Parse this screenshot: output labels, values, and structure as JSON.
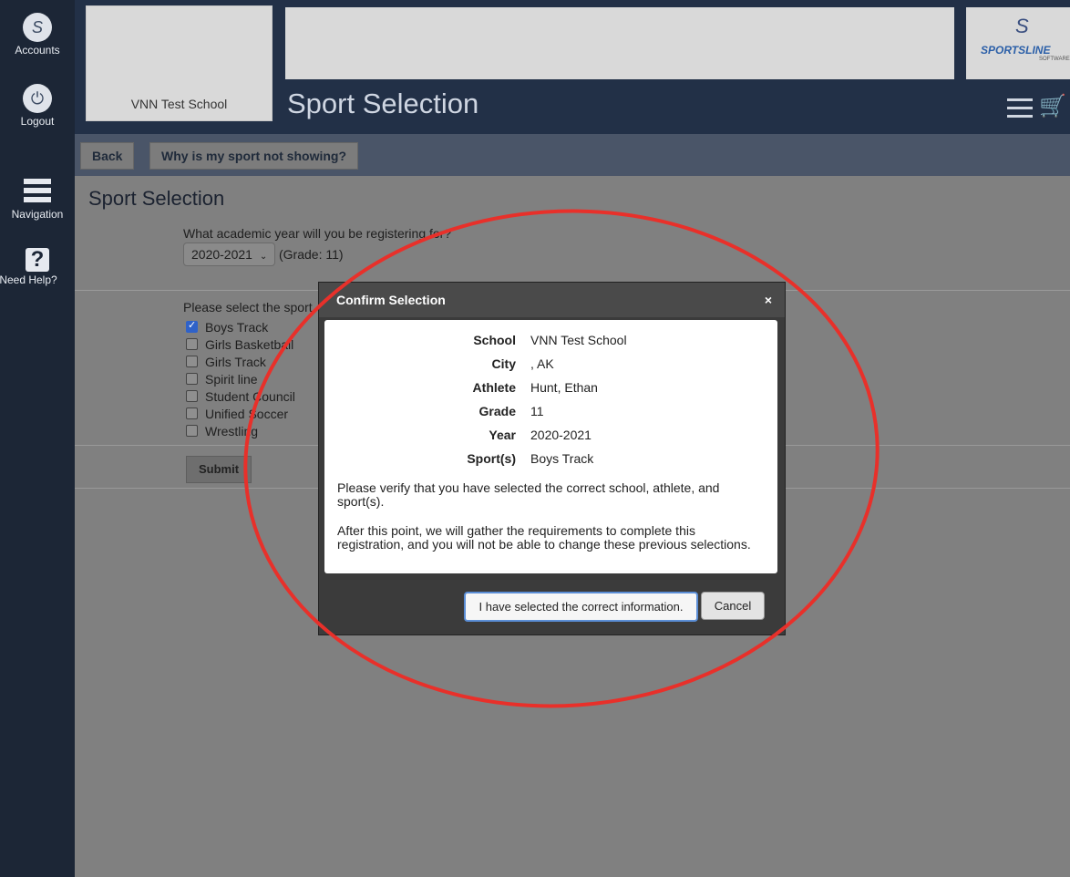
{
  "rail": {
    "accounts_label": "Accounts",
    "logout_label": "Logout",
    "navigation_label": "Navigation",
    "help_label": "Need Help?"
  },
  "header": {
    "school_name": "VNN Test School",
    "page_heading": "Sport Selection",
    "logo_s": "S",
    "logo_text": "SPORTSLINE",
    "logo_sub": "SOFTWARE"
  },
  "toolbar": {
    "back_label": "Back",
    "why_label": "Why is my sport not showing?"
  },
  "form": {
    "section_title": "Sport Selection",
    "year_question": "What academic year will you be registering for?",
    "year_selected": "2020-2021",
    "grade_note": "(Grade: 11)",
    "sport_question": "Please select the sport",
    "sports": [
      {
        "label": "Boys Track",
        "checked": true
      },
      {
        "label": "Girls Basketball",
        "checked": false
      },
      {
        "label": "Girls Track",
        "checked": false
      },
      {
        "label": "Spirit line",
        "checked": false
      },
      {
        "label": "Student Council",
        "checked": false
      },
      {
        "label": "Unified Soccer",
        "checked": false
      },
      {
        "label": "Wrestling",
        "checked": false
      }
    ],
    "submit_label": "Submit"
  },
  "modal": {
    "title": "Confirm Selection",
    "close": "×",
    "rows": [
      {
        "k": "School",
        "v": "VNN Test School"
      },
      {
        "k": "City",
        "v": ", AK"
      },
      {
        "k": "Athlete",
        "v": "Hunt, Ethan"
      },
      {
        "k": "Grade",
        "v": "11"
      },
      {
        "k": "Year",
        "v": "2020-2021"
      },
      {
        "k": "Sport(s)",
        "v": "Boys Track"
      }
    ],
    "verify_text": "Please verify that you have selected the correct school, athlete, and sport(s).",
    "after_text": "After this point, we will gather the requirements to complete this registration, and you will not be able to change these previous selections.",
    "confirm_label": "I have selected the correct information.",
    "cancel_label": "Cancel"
  },
  "colors": {
    "annotation": "#e8302a",
    "header_bg": "#223047",
    "accent_blue": "#2f62c9"
  }
}
